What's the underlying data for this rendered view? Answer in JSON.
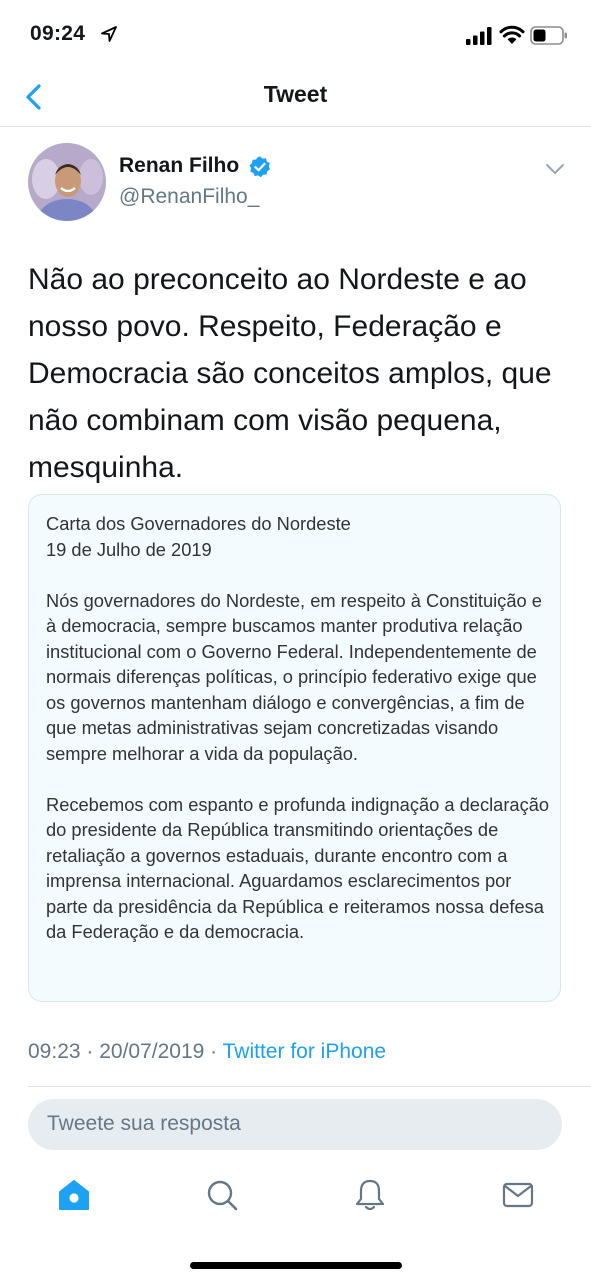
{
  "status_bar": {
    "time": "09:24"
  },
  "nav": {
    "title": "Tweet"
  },
  "author": {
    "name": "Renan Filho",
    "handle": "@RenanFilho_"
  },
  "tweet": {
    "text": "Não ao preconceito ao Nordeste e ao nosso povo. Respeito, Federação e Democracia são conceitos amplos, que não combinam com visão pequena, mesquinha."
  },
  "card": {
    "title": "Carta dos Governadores do Nordeste",
    "date": "19 de Julho de 2019",
    "paragraph1": "Nós governadores do Nordeste, em respeito à Constituição e à democracia, sempre buscamos manter produtiva relação institucional com o Governo Federal. Independentemente de normais diferenças políticas, o princípio federativo exige que os governos mantenham diálogo e convergências, a fim de que metas administrativas sejam concretizadas visando sempre melhorar a vida da população.",
    "paragraph2": "Recebemos com espanto e profunda indignação a declaração do presidente da República transmitindo orientações de retaliação a governos estaduais, durante encontro com a imprensa internacional. Aguardamos esclarecimentos por parte da presidência da República e reiteramos nossa defesa da Federação e da democracia."
  },
  "meta": {
    "time": "09:23",
    "separator": " · ",
    "date": "20/07/2019",
    "source": "Twitter for iPhone"
  },
  "reply": {
    "placeholder": "Tweete sua resposta"
  },
  "tabs": [
    "home-icon",
    "search-icon",
    "bell-icon",
    "mail-icon"
  ],
  "colors": {
    "accent": "#1da1f2",
    "secondary_text": "#657786",
    "card_bg": "#f3fbfe"
  }
}
